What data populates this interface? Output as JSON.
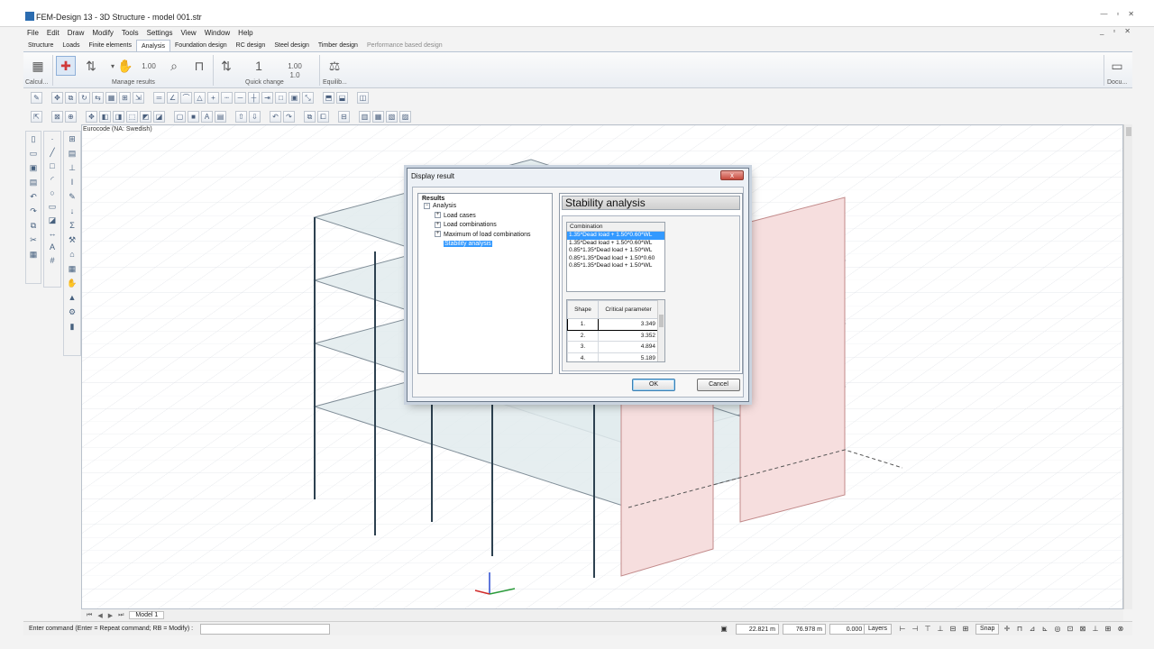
{
  "window": {
    "title": "FEM-Design 13 - 3D Structure - model 001.str",
    "controls": [
      "—",
      "▫",
      "✕"
    ]
  },
  "menu": [
    "File",
    "Edit",
    "Draw",
    "Modify",
    "Tools",
    "Settings",
    "View",
    "Window",
    "Help"
  ],
  "mdi_controls": [
    "_",
    "▫",
    "✕"
  ],
  "tabs": [
    {
      "label": "Structure",
      "state": "normal"
    },
    {
      "label": "Loads",
      "state": "normal"
    },
    {
      "label": "Finite elements",
      "state": "normal"
    },
    {
      "label": "Analysis",
      "state": "active"
    },
    {
      "label": "Foundation design",
      "state": "normal"
    },
    {
      "label": "RC design",
      "state": "normal"
    },
    {
      "label": "Steel design",
      "state": "normal"
    },
    {
      "label": "Timber design",
      "state": "normal"
    },
    {
      "label": "Performance based design",
      "state": "disabled"
    }
  ],
  "ribbon": {
    "group_calculate": "Calcul...",
    "group_manage_results": "Manage results",
    "group_quick_change": "Quick change",
    "group_equilibrium": "Equilib...",
    "group_documentation": "Docu...",
    "value_a": "1.00",
    "value_b": "1.00",
    "value_c": "1.0"
  },
  "viewport": {
    "code_label": "Eurocode (NA: Swedish)"
  },
  "model_tab": "Model 1",
  "status_bar": {
    "command_label": "Enter command (Enter = Repeat command; RB = Modify) :",
    "x": "22.821 m",
    "y": "76.978 m",
    "z": "0.000 m",
    "layers": "Layers",
    "snap": "Snap"
  },
  "dialog": {
    "title": "Display result",
    "close": "x",
    "tree_root": "Results",
    "tree": [
      {
        "label": "Analysis",
        "expander": "−",
        "level": 0
      },
      {
        "label": "Load cases",
        "expander": "+",
        "level": 1
      },
      {
        "label": "Load combinations",
        "expander": "+",
        "level": 1
      },
      {
        "label": "Maximum of load combinations",
        "expander": "+",
        "level": 1
      },
      {
        "label": "Stability analysis",
        "expander": "",
        "level": 1,
        "selected": true
      }
    ],
    "panel_title": "Stability analysis",
    "combination_header": "Combination",
    "combinations": [
      {
        "label": "1.35*Dead load + 1.50*0.60*WL",
        "selected": true
      },
      {
        "label": "1.35*Dead load + 1.50*0.60*WL",
        "selected": false
      },
      {
        "label": "0.85*1.35*Dead load + 1.50*WL",
        "selected": false
      },
      {
        "label": "0.85*1.35*Dead load + 1.50*0.60",
        "selected": false
      },
      {
        "label": "0.85*1.35*Dead load + 1.50*WL",
        "selected": false
      }
    ],
    "shape_header": "Shape",
    "critical_header": "Critical parameter",
    "shapes": [
      {
        "n": "1.",
        "value": "3.349",
        "selected": true
      },
      {
        "n": "2.",
        "value": "3.352",
        "selected": false
      },
      {
        "n": "3.",
        "value": "4.894",
        "selected": false
      },
      {
        "n": "4.",
        "value": "5.189",
        "selected": false
      }
    ],
    "ok": "OK",
    "cancel": "Cancel"
  }
}
